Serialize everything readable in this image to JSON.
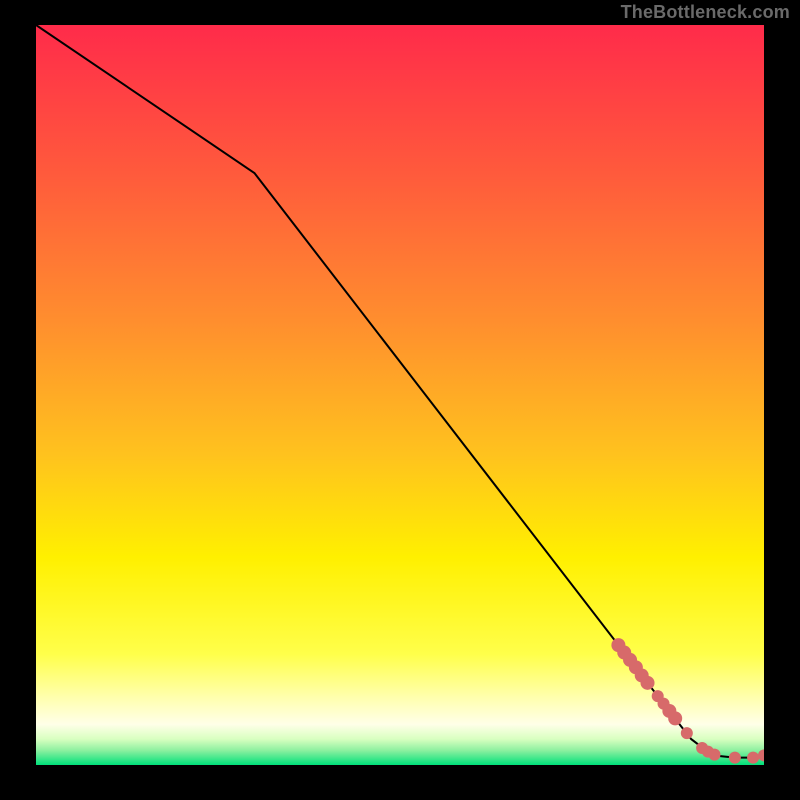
{
  "watermark": "TheBottleneck.com",
  "colors": {
    "line": "#000000",
    "marker_fill": "#d76a6a",
    "marker_stroke": "#c85a5a",
    "frame": "#000000"
  },
  "chart_data": {
    "type": "line",
    "title": "",
    "xlabel": "",
    "ylabel": "",
    "xlim": [
      0,
      100
    ],
    "ylim": [
      0,
      100
    ],
    "grid": false,
    "legend": false,
    "background_gradient": {
      "stops": [
        {
          "offset": 0.0,
          "color": "#ff2b4a"
        },
        {
          "offset": 0.2,
          "color": "#ff5a3c"
        },
        {
          "offset": 0.4,
          "color": "#ff8e2e"
        },
        {
          "offset": 0.58,
          "color": "#ffc21e"
        },
        {
          "offset": 0.72,
          "color": "#fff000"
        },
        {
          "offset": 0.85,
          "color": "#ffff4a"
        },
        {
          "offset": 0.91,
          "color": "#ffffb0"
        },
        {
          "offset": 0.945,
          "color": "#ffffe8"
        },
        {
          "offset": 0.965,
          "color": "#d8ffc0"
        },
        {
          "offset": 0.98,
          "color": "#8ef0a0"
        },
        {
          "offset": 1.0,
          "color": "#00e07a"
        }
      ]
    },
    "series": [
      {
        "name": "curve",
        "x": [
          0,
          30,
          88,
          90,
          92,
          94,
          96,
          98,
          100
        ],
        "y": [
          100,
          80,
          6,
          3.5,
          2,
          1.2,
          1,
          1,
          1.2
        ]
      }
    ],
    "markers": [
      {
        "x": 80.0,
        "y": 16.2,
        "r": 7
      },
      {
        "x": 80.8,
        "y": 15.2,
        "r": 7
      },
      {
        "x": 81.6,
        "y": 14.2,
        "r": 7
      },
      {
        "x": 82.4,
        "y": 13.2,
        "r": 7
      },
      {
        "x": 83.2,
        "y": 12.1,
        "r": 7
      },
      {
        "x": 84.0,
        "y": 11.1,
        "r": 7
      },
      {
        "x": 85.4,
        "y": 9.3,
        "r": 6
      },
      {
        "x": 86.2,
        "y": 8.3,
        "r": 6
      },
      {
        "x": 87.0,
        "y": 7.3,
        "r": 7
      },
      {
        "x": 87.8,
        "y": 6.3,
        "r": 7
      },
      {
        "x": 89.4,
        "y": 4.3,
        "r": 6
      },
      {
        "x": 91.5,
        "y": 2.3,
        "r": 6
      },
      {
        "x": 92.3,
        "y": 1.8,
        "r": 6
      },
      {
        "x": 93.2,
        "y": 1.4,
        "r": 6
      },
      {
        "x": 96.0,
        "y": 1.0,
        "r": 6
      },
      {
        "x": 98.5,
        "y": 1.0,
        "r": 6
      },
      {
        "x": 100.0,
        "y": 1.3,
        "r": 6
      }
    ]
  }
}
